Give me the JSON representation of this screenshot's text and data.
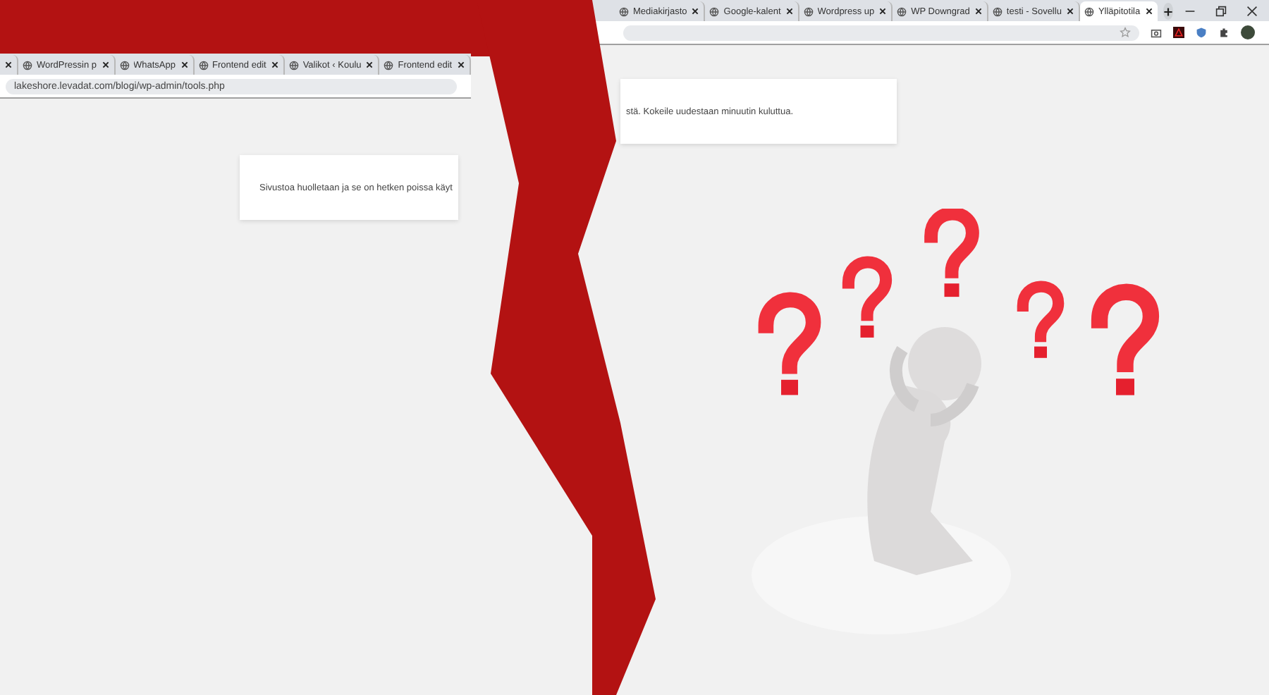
{
  "left_window": {
    "tabs": [
      {
        "title": "WordPressin p",
        "selected": false
      },
      {
        "title": "WhatsApp",
        "selected": false
      },
      {
        "title": "Frontend edit",
        "selected": false
      },
      {
        "title": "Valikot ‹ Koulu",
        "selected": false
      },
      {
        "title": "Frontend edit",
        "selected": false
      }
    ],
    "url": "lakeshore.levadat.com/blogi/wp-admin/tools.php",
    "notice": "Sivustoa huolletaan ja se on hetken poissa käyt"
  },
  "right_window": {
    "tabs": [
      {
        "title": "Mediakirjasto",
        "selected": false
      },
      {
        "title": "Google-kalent",
        "selected": false
      },
      {
        "title": "Wordpress up",
        "selected": false
      },
      {
        "title": "WP Downgrad",
        "selected": false
      },
      {
        "title": "testi - Sovellu",
        "selected": false
      },
      {
        "title": "Ylläpitotila",
        "selected": true
      }
    ],
    "notice": "stä. Kokeile uudestaan minuutin kuluttua."
  }
}
